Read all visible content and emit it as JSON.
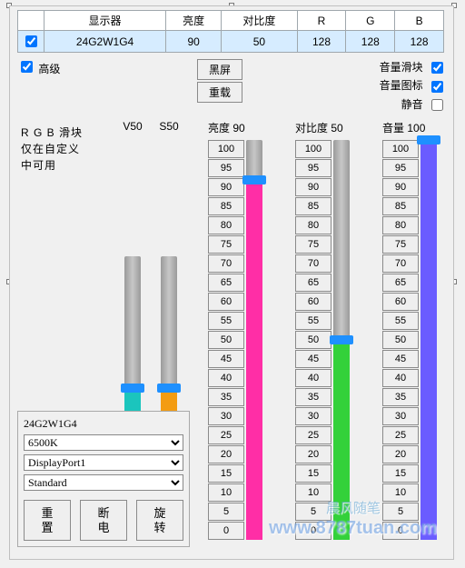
{
  "table": {
    "headers": [
      "显示器",
      "亮度",
      "对比度",
      "R",
      "G",
      "B"
    ],
    "rows": [
      {
        "checked": true,
        "cells": [
          "24G2W1G4",
          "90",
          "50",
          "128",
          "128",
          "128"
        ]
      }
    ]
  },
  "advanced": {
    "label": "高级",
    "checked": true
  },
  "mid_buttons": {
    "black_screen": "黑屏",
    "reload": "重载"
  },
  "right_opts": {
    "volume_slider": {
      "label": "音量滑块",
      "checked": true
    },
    "volume_icon": {
      "label": "音量图标",
      "checked": true
    },
    "mute": {
      "label": "静音",
      "checked": false
    }
  },
  "rgb_note": {
    "line1": "R G B 滑块",
    "line2": "仅在自定义",
    "line3": "中可用"
  },
  "vs": {
    "v": {
      "label": "V50",
      "pct": 50,
      "fill": "#1bc5bd"
    },
    "s": {
      "label": "S50",
      "pct": 50,
      "fill": "#f39c12"
    }
  },
  "scales": {
    "steps": [
      "100",
      "95",
      "90",
      "85",
      "80",
      "75",
      "70",
      "65",
      "60",
      "55",
      "50",
      "45",
      "40",
      "35",
      "30",
      "25",
      "20",
      "15",
      "10",
      "5",
      "0"
    ],
    "brightness": {
      "label": "亮度",
      "value": 90,
      "fill": "#ff2ea6"
    },
    "contrast": {
      "label": "对比度",
      "value": 50,
      "fill": "#33d13a"
    },
    "volume": {
      "label": "音量",
      "value": 100,
      "fill": "#6a5cff"
    }
  },
  "ctrl": {
    "title": "24G2W1G4",
    "color_temp": "6500K",
    "input": "DisplayPort1",
    "mode": "Standard",
    "reset": "重\n置",
    "power": "断\n电",
    "rotate": "旋\n转"
  },
  "watermark": {
    "small": "晨风随笔",
    "big": "www.8787tuan.com"
  }
}
